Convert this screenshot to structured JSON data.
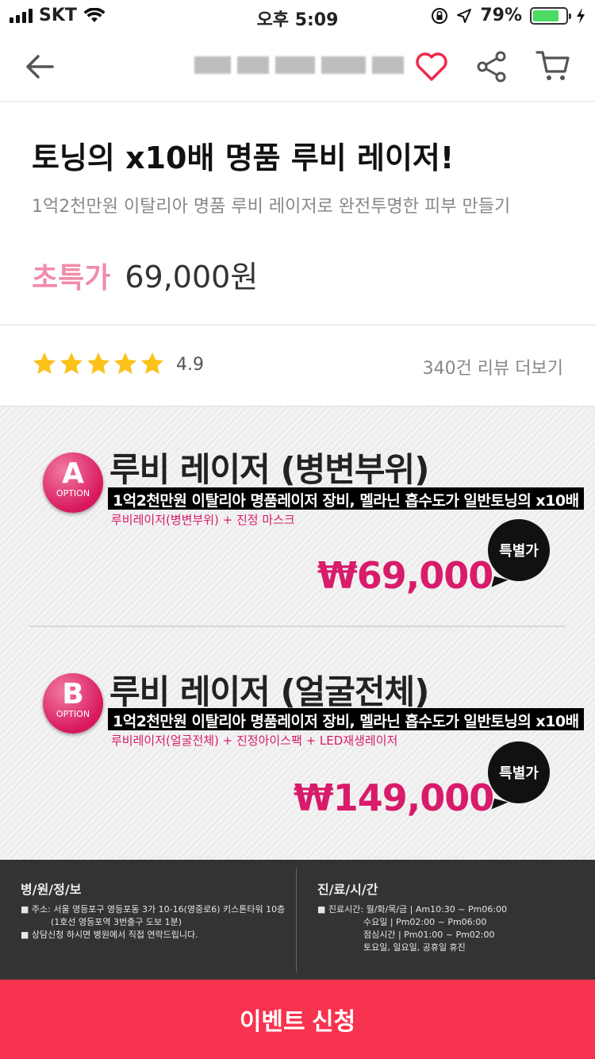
{
  "status": {
    "carrier": "SKT",
    "time": "오후 5:09",
    "battery": "79%",
    "battery_level": 0.79
  },
  "nav": {
    "back_icon": "arrow-left-icon",
    "heart_icon": "heart-icon",
    "share_icon": "share-icon",
    "cart_icon": "cart-icon"
  },
  "product": {
    "title": "토닝의 x10배 명품 루비 레이저!",
    "subtitle": "1억2천만원 이탈리아 명품 루비 레이저로 완전투명한 피부 만들기",
    "price_label": "초특가",
    "price": "69,000원"
  },
  "rating": {
    "stars": 5,
    "value": "4.9",
    "reviews_link": "340건 리뷰 더보기"
  },
  "options": [
    {
      "letter": "A",
      "badge_label": "OPTION",
      "title": "루비 레이저 (병변부위)",
      "desc": "1억2천만원 이탈리아 명품레이저 장비, 멜라닌 흡수도가 일반토닝의 x10배",
      "sub": "루비레이저(병변부위) + 진정 마스크",
      "price": "₩69,000",
      "bubble": "특별가"
    },
    {
      "letter": "B",
      "badge_label": "OPTION",
      "title": "루비 레이저 (얼굴전체)",
      "desc": "1억2천만원 이탈리아 명품레이저 장비, 멜라닌 흡수도가 일반토닝의 x10배",
      "sub": "루비레이저(얼굴전체) + 진정아이스팩 + LED재생레이저",
      "price": "₩149,000",
      "bubble": "특별가"
    }
  ],
  "hospital": {
    "title": "병/원/정/보",
    "line1": "■ 주소: 서울 영등포구 영등포동 3가 10-16(영중로6) 키스톤타워 10층",
    "line2": "(1호선 영등포역 3번출구 도보 1분)",
    "line3": "■ 상담신청 하시면 병원에서 직접 연락드립니다."
  },
  "hours": {
    "title": "진/료/시/간",
    "line1": "■ 진료시간: 월/화/목/금 | Am10:30 ~ Pm06:00",
    "line2": "수요일 | Pm02:00 ~ Pm06:00",
    "line3": "점심시간 | Pm01:00 ~ Pm02:00",
    "line4": "토요일, 일요일, 공휴일 휴진"
  },
  "cta": {
    "label": "이벤트 신청"
  }
}
